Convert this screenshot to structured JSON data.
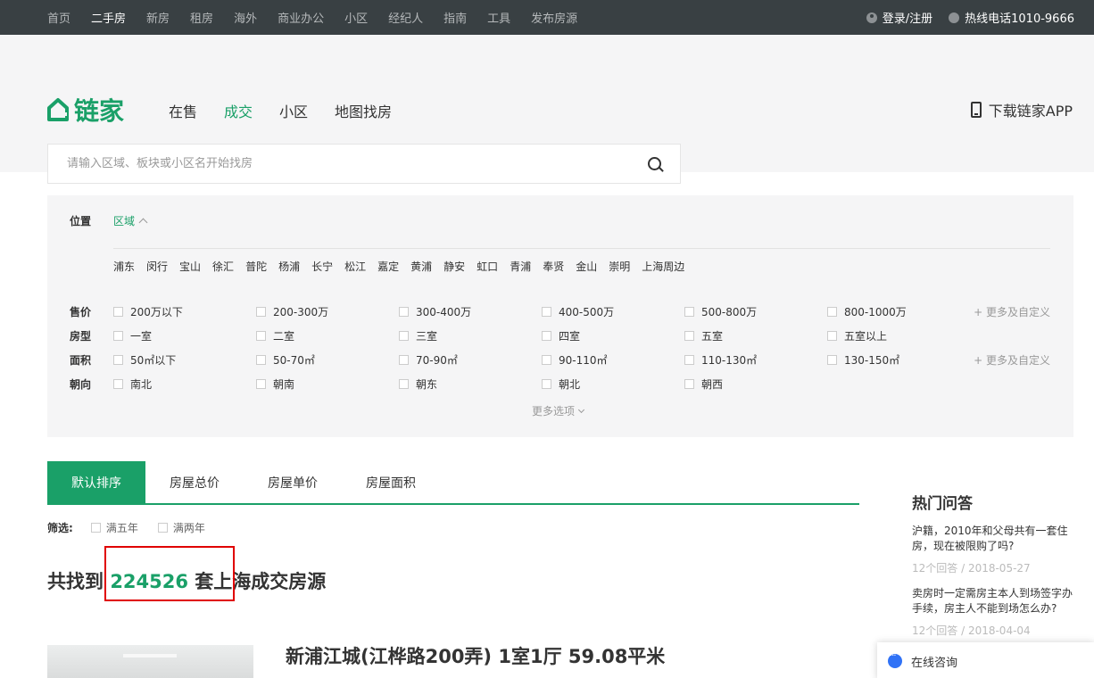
{
  "topbar": {
    "nav": [
      "首页",
      "二手房",
      "新房",
      "租房",
      "海外",
      "商业办公",
      "小区",
      "经纪人",
      "指南",
      "工具",
      "发布房源"
    ],
    "active_index": 1,
    "login": "登录/注册",
    "hotline": "热线电话1010-9666"
  },
  "header": {
    "logo_text": "链家",
    "nav": [
      "在售",
      "成交",
      "小区",
      "地图找房"
    ],
    "active_index": 1,
    "app_download": "下载链家APP",
    "search_placeholder": "请输入区域、板块或小区名开始找房"
  },
  "filter": {
    "location_label": "位置",
    "location_tab": "区域",
    "districts": [
      "浦东",
      "闵行",
      "宝山",
      "徐汇",
      "普陀",
      "杨浦",
      "长宁",
      "松江",
      "嘉定",
      "黄浦",
      "静安",
      "虹口",
      "青浦",
      "奉贤",
      "金山",
      "崇明",
      "上海周边"
    ],
    "price": {
      "label": "售价",
      "options": [
        "200万以下",
        "200-300万",
        "300-400万",
        "400-500万",
        "500-800万",
        "800-1000万"
      ],
      "more": "+ 更多及自定义"
    },
    "layout": {
      "label": "房型",
      "options": [
        "一室",
        "二室",
        "三室",
        "四室",
        "五室",
        "五室以上"
      ]
    },
    "area": {
      "label": "面积",
      "options": [
        "50㎡以下",
        "50-70㎡",
        "70-90㎡",
        "90-110㎡",
        "110-130㎡",
        "130-150㎡"
      ],
      "more": "+ 更多及自定义"
    },
    "orientation": {
      "label": "朝向",
      "options": [
        "南北",
        "朝南",
        "朝东",
        "朝北",
        "朝西"
      ]
    },
    "more_options": "更多选项"
  },
  "sort_tabs": [
    "默认排序",
    "房屋总价",
    "房屋单价",
    "房屋面积"
  ],
  "screening": {
    "label": "筛选:",
    "options": [
      "满五年",
      "满两年"
    ]
  },
  "result": {
    "prefix": "共找到",
    "count": "224526",
    "suffix": "套上海成交房源"
  },
  "listing": {
    "title": "新浦江城(江桦路200弄) 1室1厅 59.08平米"
  },
  "sidebar": {
    "title": "热门问答",
    "questions": [
      {
        "text": "沪籍，2010年和父母共有一套住房，现在被限购了吗?",
        "meta": "12个回答 / 2018-05-27"
      },
      {
        "text": "卖房时一定需房主本人到场签字办手续，房主人不能到场怎么办?",
        "meta": "12个回答 / 2018-04-04"
      }
    ],
    "consult": "在线咨询"
  }
}
